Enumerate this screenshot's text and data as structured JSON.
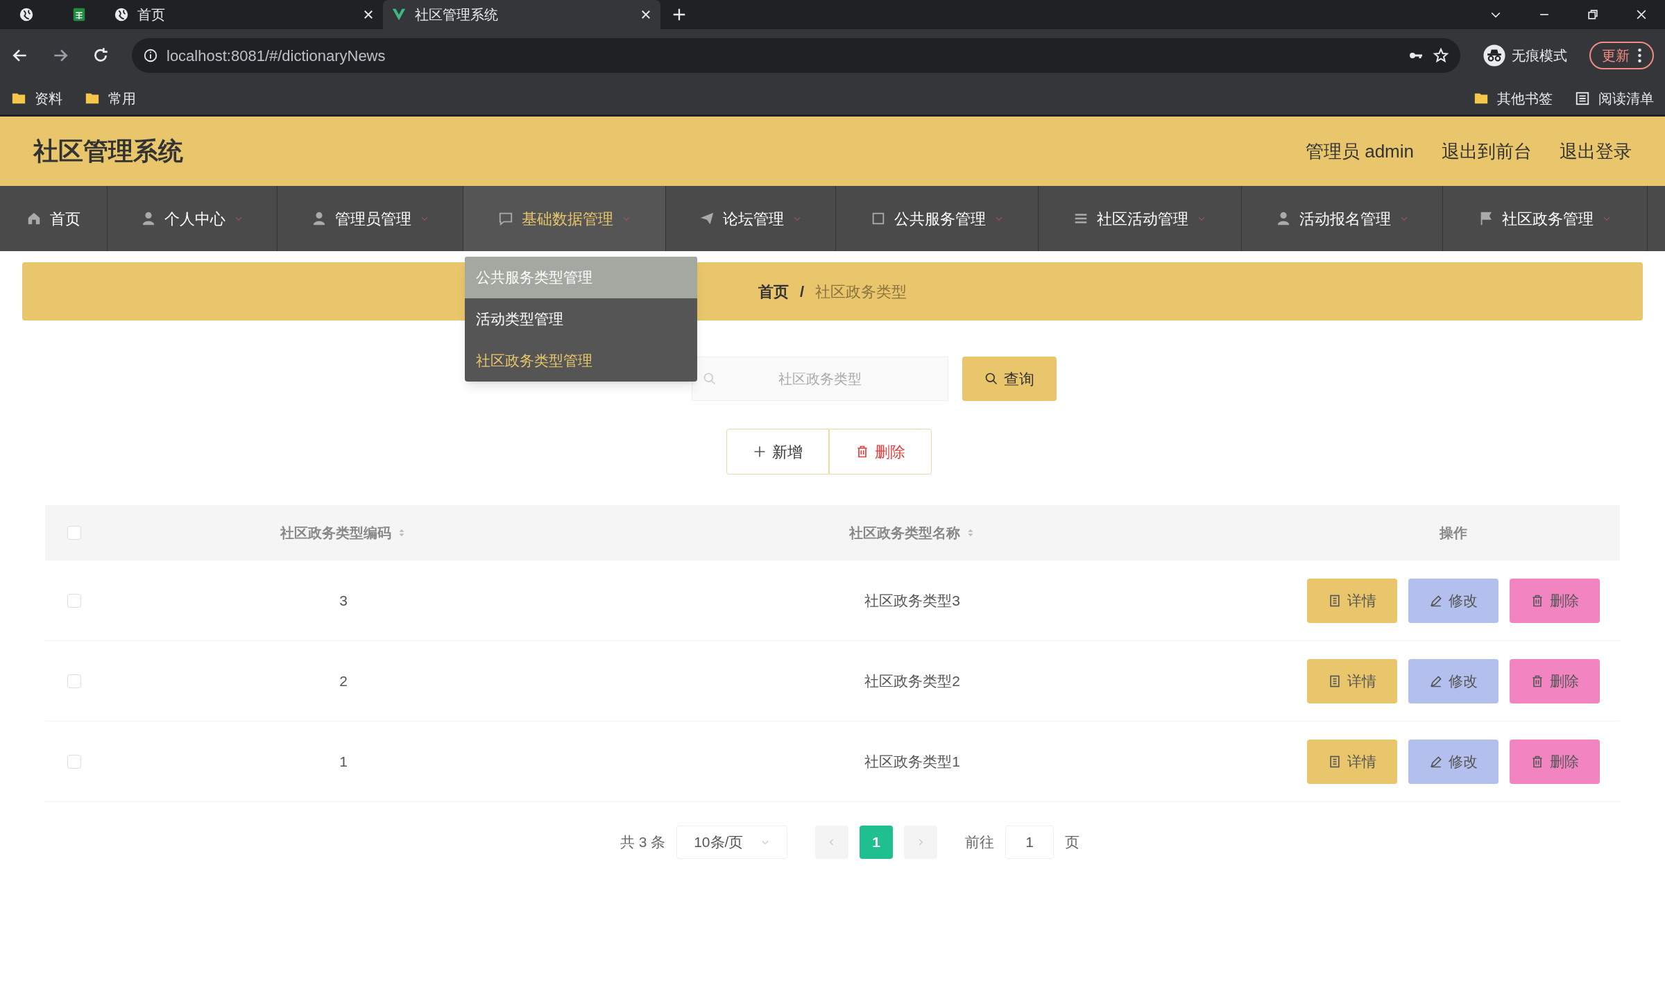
{
  "browser": {
    "tabs": [
      {
        "kind": "pinned",
        "selected": false
      },
      {
        "kind": "sheet",
        "selected": false
      },
      {
        "kind": "page",
        "title": "首页",
        "selected": false
      },
      {
        "kind": "page",
        "title": "社区管理系统",
        "selected": true
      }
    ],
    "address": "localhost:8081/#/dictionaryNews",
    "profile": "无痕模式",
    "update_button": "更新",
    "bookmarks": [
      "资料",
      "常用"
    ],
    "bookmarks_right": [
      "其他书签",
      "阅读清单"
    ]
  },
  "header": {
    "title": "社区管理系统",
    "user": "管理员 admin",
    "links": [
      "退出到前台",
      "退出登录"
    ]
  },
  "nav": [
    {
      "label": "首页",
      "selected": false
    },
    {
      "label": "个人中心",
      "selected": false
    },
    {
      "label": "管理员管理",
      "selected": false
    },
    {
      "label": "基础数据管理",
      "selected": true
    },
    {
      "label": "论坛管理",
      "selected": false
    },
    {
      "label": "公共服务管理",
      "selected": false
    },
    {
      "label": "社区活动管理",
      "selected": false
    },
    {
      "label": "活动报名管理",
      "selected": false
    },
    {
      "label": "社区政务管理",
      "selected": false
    }
  ],
  "dropdown": [
    {
      "label": "公共服务类型管理",
      "hovered": true,
      "selected": false
    },
    {
      "label": "活动类型管理",
      "hovered": false,
      "selected": false
    },
    {
      "label": "社区政务类型管理",
      "hovered": false,
      "selected": true
    }
  ],
  "breadcrumb": {
    "items": [
      "首页",
      "社区政务类型"
    ],
    "separator": "/"
  },
  "search": {
    "placeholder": "社区政务类型",
    "button": "查询"
  },
  "toolbar": {
    "add": "新增",
    "delete": "删除"
  },
  "table": {
    "all_checked": false,
    "columns": [
      {
        "label": "社区政务类型编码",
        "sortable": true
      },
      {
        "label": "社区政务类型名称",
        "sortable": true
      },
      {
        "label": "操作",
        "sortable": false
      }
    ],
    "rows": [
      {
        "checked": false,
        "code": "3",
        "name": "社区政务类型3",
        "actions": [
          "详情",
          "修改",
          "删除"
        ]
      },
      {
        "checked": false,
        "code": "2",
        "name": "社区政务类型2",
        "actions": [
          "详情",
          "修改",
          "删除"
        ]
      },
      {
        "checked": false,
        "code": "1",
        "name": "社区政务类型1",
        "actions": [
          "详情",
          "修改",
          "删除"
        ]
      }
    ]
  },
  "pagination": {
    "total": "共 3 条",
    "page_size": "10条/页",
    "pages": [
      {
        "label": "1",
        "selected": true
      }
    ],
    "jump_label": "前往",
    "jump_value": "1",
    "jump_suffix": "页"
  }
}
